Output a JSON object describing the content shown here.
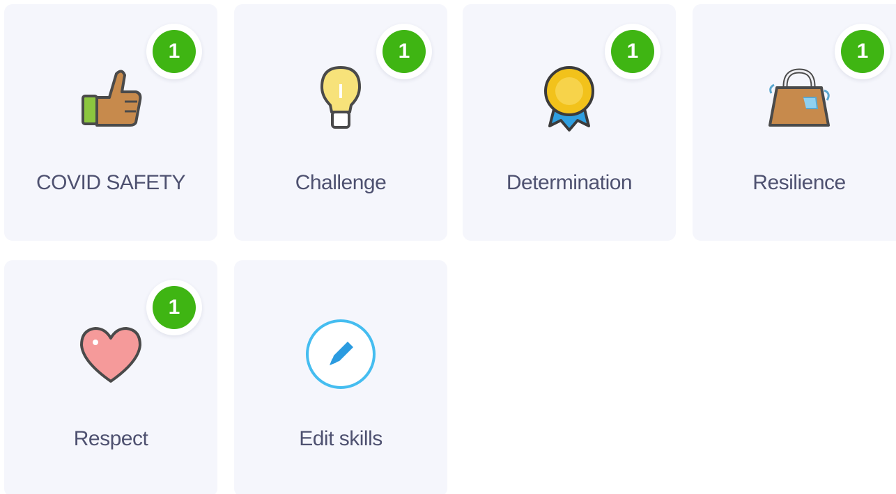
{
  "skills": [
    {
      "label": "COVID SAFETY",
      "count": "1",
      "icon": "thumbs-up-icon"
    },
    {
      "label": "Challenge",
      "count": "1",
      "icon": "lightbulb-icon"
    },
    {
      "label": "Determination",
      "count": "1",
      "icon": "medal-icon"
    },
    {
      "label": "Resilience",
      "count": "1",
      "icon": "kettlebell-icon"
    },
    {
      "label": "Respect",
      "count": "1",
      "icon": "heart-icon"
    }
  ],
  "edit": {
    "label": "Edit skills",
    "icon": "pencil-icon"
  },
  "colors": {
    "badge": "#3fb513",
    "card_bg": "#f5f6fc",
    "label_text": "#4e5170",
    "edit_accent": "#45bdf0"
  }
}
